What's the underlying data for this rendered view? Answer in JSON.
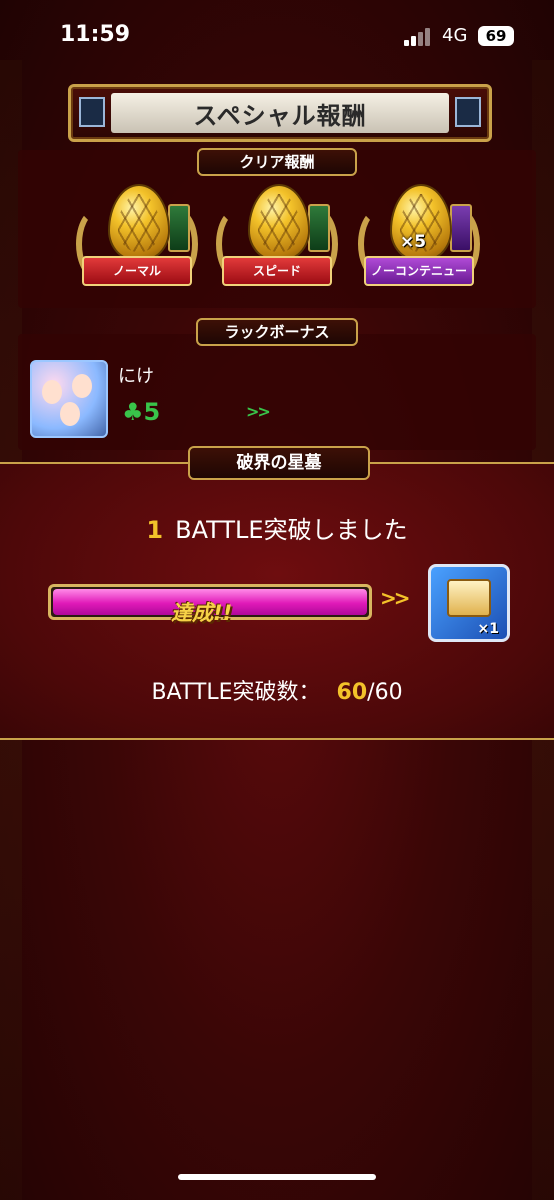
{
  "status_bar": {
    "time": "11:59",
    "network": "4G",
    "battery": "69"
  },
  "title": "スペシャル報酬",
  "clear_rewards": {
    "label": "クリア報酬",
    "items": [
      {
        "ribbon": "ノーマル",
        "multiplier": ""
      },
      {
        "ribbon": "スピード",
        "multiplier": ""
      },
      {
        "ribbon": "ノーコンテニュー",
        "multiplier": "×5"
      }
    ]
  },
  "luck_bonus": {
    "label": "ラックボーナス",
    "character_name": "にけ",
    "luck_value": "5",
    "arrows": ">>"
  },
  "tomb": {
    "label": "破界の星墓",
    "battle_num": "1",
    "battle_text": "BATTLE突破しました",
    "progress": 1.0,
    "progress_label": "達成!!",
    "arrows": ">>",
    "reward_qty": "×1",
    "count_label": "BATTLE突破数：",
    "count_current": "60",
    "count_total": "/60"
  },
  "colors": {
    "gold": "#f3c22a",
    "luck_green": "#39c44a",
    "progress_pink": "#e01ab8"
  }
}
